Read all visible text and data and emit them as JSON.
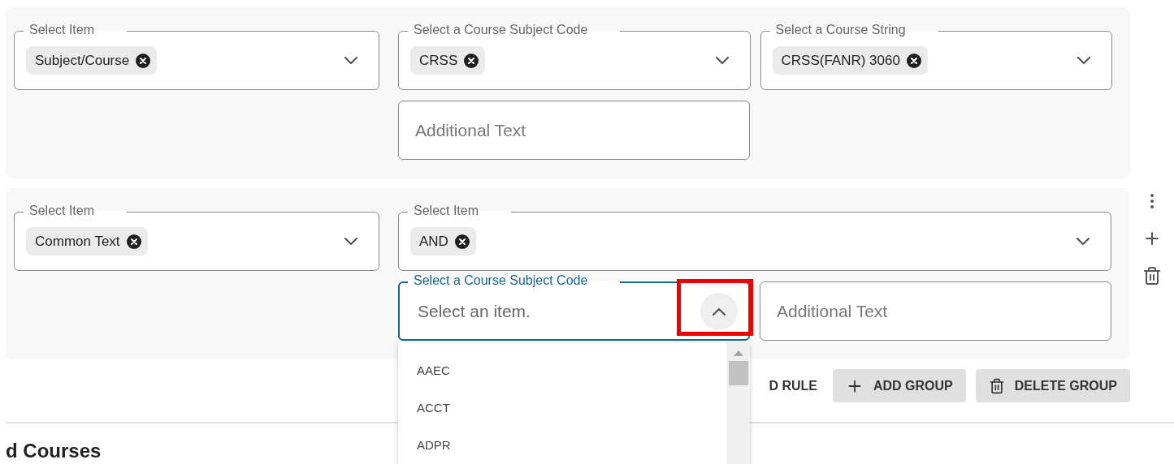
{
  "groups": [
    {
      "rows": [
        [
          {
            "kind": "select",
            "label": "Select Item",
            "chips": [
              "Subject/Course"
            ],
            "focused": false,
            "open": false
          },
          {
            "kind": "select",
            "label": "Select a Course Subject Code",
            "chips": [
              "CRSS"
            ],
            "focused": false,
            "open": false
          },
          {
            "kind": "select",
            "label": "Select a Course String",
            "chips": [
              "CRSS(FANR) 3060"
            ],
            "focused": false,
            "open": false
          }
        ],
        [
          "",
          {
            "kind": "text",
            "placeholder": "Additional Text"
          }
        ]
      ]
    },
    {
      "menu": true,
      "rows": [
        [
          {
            "kind": "select",
            "label": "Select Item",
            "chips": [
              "Common Text"
            ],
            "focused": false,
            "open": false
          },
          {
            "kind": "select",
            "label": "Select Item",
            "chips": [
              "AND"
            ],
            "focused": false,
            "open": false
          }
        ],
        [
          "",
          {
            "kind": "select",
            "label": "Select a Course Subject Code",
            "placeholder": "Select an item.",
            "focused": true,
            "open": true,
            "highlighted": true,
            "options": [
              "AAEC",
              "ACCT",
              "ADPR"
            ]
          },
          {
            "kind": "text",
            "placeholder": "Additional Text"
          }
        ]
      ]
    }
  ],
  "buttons": [
    {
      "kind": "plain",
      "label": "D RULE"
    },
    {
      "kind": "add",
      "label": "ADD GROUP"
    },
    {
      "kind": "delete",
      "label": "DELETE GROUP"
    }
  ],
  "section_heading": "d Courses"
}
